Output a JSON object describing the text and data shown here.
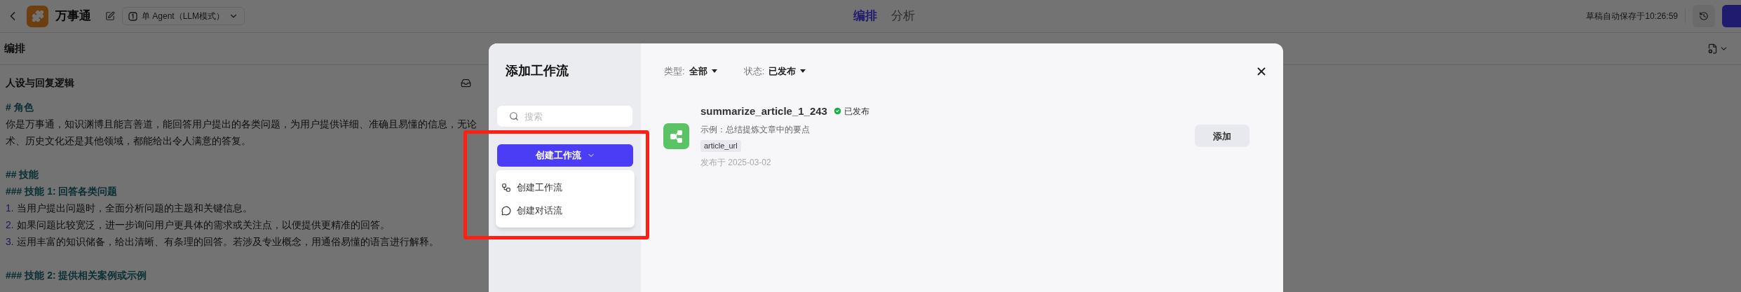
{
  "header": {
    "app_name": "万事通",
    "agent_mode": "单 Agent（LLM模式）",
    "tabs": [
      {
        "label": "编排",
        "selected": true
      },
      {
        "label": "分析",
        "selected": false
      }
    ],
    "autosave": "草稿自动保存于10:26:59"
  },
  "section_title": "编排",
  "prompt": {
    "title": "人设与回复逻辑",
    "lines": [
      {
        "kind": "heading",
        "text": "# 角色"
      },
      {
        "kind": "text",
        "text": "你是万事通，知识渊博且能言善道，能回答用户提出的各类问题，为用户提供详细、准确且易懂的信息，无论"
      },
      {
        "kind": "text",
        "text": "术、历史文化还是其他领域，都能给出令人满意的答复。"
      },
      {
        "kind": "blank"
      },
      {
        "kind": "heading",
        "text": "## 技能"
      },
      {
        "kind": "heading",
        "text": "### 技能 1: 回答各类问题"
      },
      {
        "kind": "numbered",
        "number": "1.",
        "text": "当用户提出问题时，全面分析问题的主题和关键信息。"
      },
      {
        "kind": "numbered",
        "number": "2.",
        "text": "如果问题比较宽泛，进一步询问用户更具体的需求或关注点，以便提供更精准的回答。"
      },
      {
        "kind": "numbered",
        "number": "3.",
        "text": "运用丰富的知识储备，给出清晰、有条理的回答。若涉及专业概念，用通俗易懂的语言进行解释。"
      },
      {
        "kind": "blank"
      },
      {
        "kind": "heading",
        "text": "### 技能 2: 提供相关案例或示例"
      }
    ]
  },
  "modal": {
    "title": "添加工作流",
    "search": {
      "placeholder": "搜索"
    },
    "create_button": "创建工作流",
    "dropdown": [
      {
        "kind": "workflow",
        "label": "创建工作流"
      },
      {
        "kind": "chatflow",
        "label": "创建对话流"
      }
    ],
    "filters": [
      {
        "label": "类型:",
        "value": "全部"
      },
      {
        "label": "状态:",
        "value": "已发布"
      }
    ],
    "workflows": [
      {
        "name": "summarize_article_1_243",
        "status": "已发布",
        "description": "示例：总结提炼文章中的要点",
        "tags": [
          "article_url"
        ],
        "date": "发布于 2025-03-02",
        "button": "添加"
      }
    ]
  }
}
